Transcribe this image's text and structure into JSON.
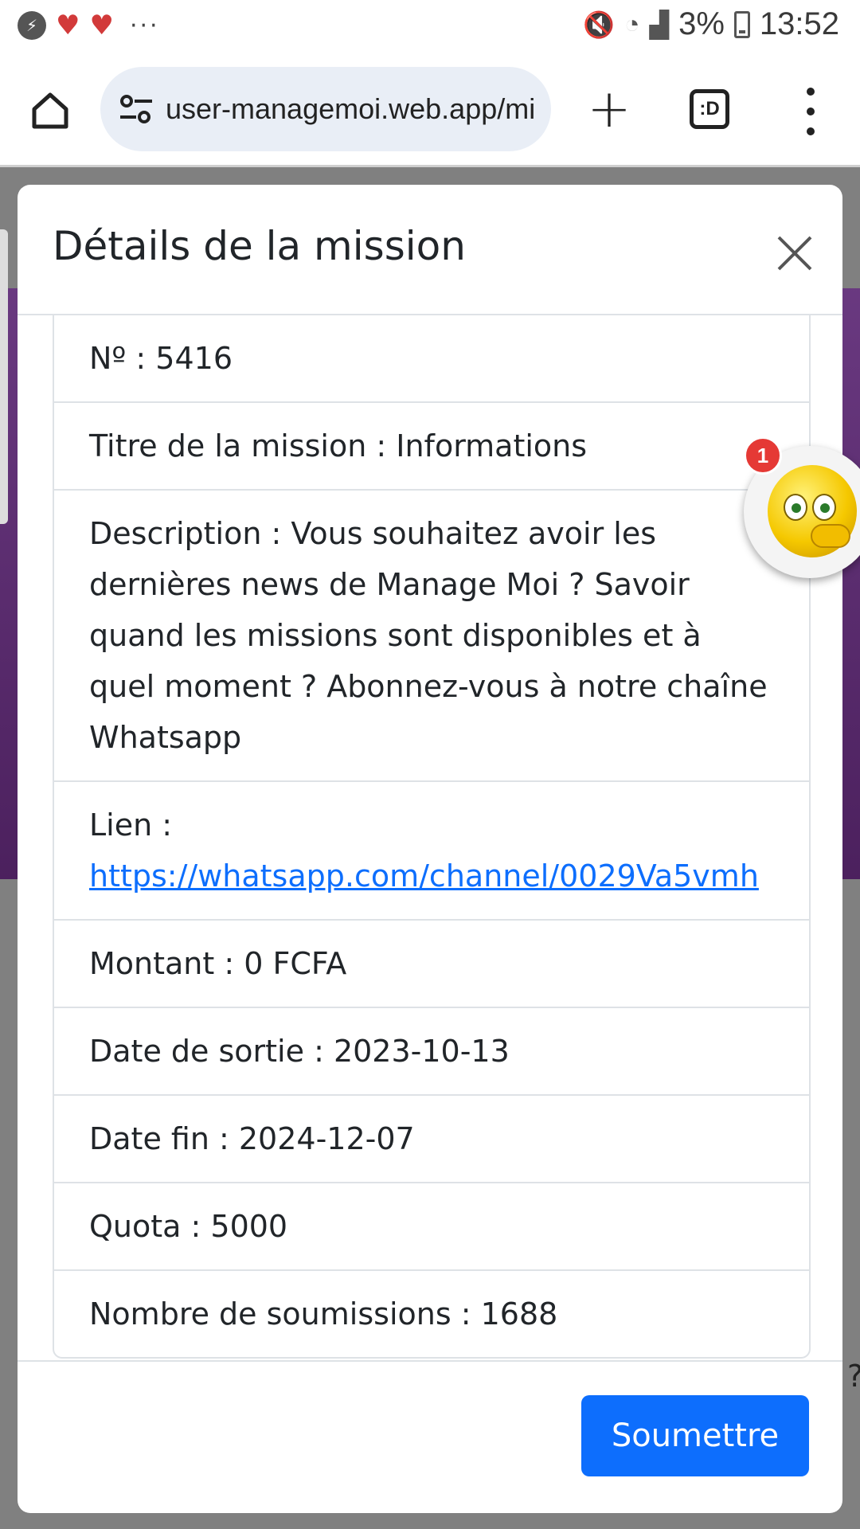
{
  "status_bar": {
    "time": "13:52",
    "battery": "3%",
    "notifications": [
      "messenger-icon",
      "heart-icon",
      "heart-icon"
    ],
    "more": "···"
  },
  "browser": {
    "url": "user-managemoi.web.app/mi",
    "tabs_label": ":D",
    "new_tab": "+"
  },
  "modal": {
    "title": "Détails de la mission",
    "details": [
      "Nº : 5416",
      "Titre de la mission : Informations",
      "Description : Vous souhaitez avoir les dernières news de Manage Moi ? Savoir quand les missions sont disponibles et à quel moment ? Abonnez-vous à notre chaîne Whatsapp",
      "Lien :",
      "Montant : 0 FCFA",
      "Date de sortie : 2023-10-13",
      "Date fin : 2024-12-07",
      "Quota : 5000",
      "Nombre de soumissions : 1688"
    ],
    "link": "https://whatsapp.com/channel/0029Va5vmh",
    "submit_label": "Soumettre"
  },
  "chat_bubble": {
    "badge_count": "1"
  },
  "background": {
    "edge_text": "?"
  },
  "colors": {
    "primary": "#0d6efd",
    "badge": "#e53935",
    "url_bar": "#e9eef6",
    "backdrop": "#808080",
    "purple": "#5b2d6e"
  }
}
